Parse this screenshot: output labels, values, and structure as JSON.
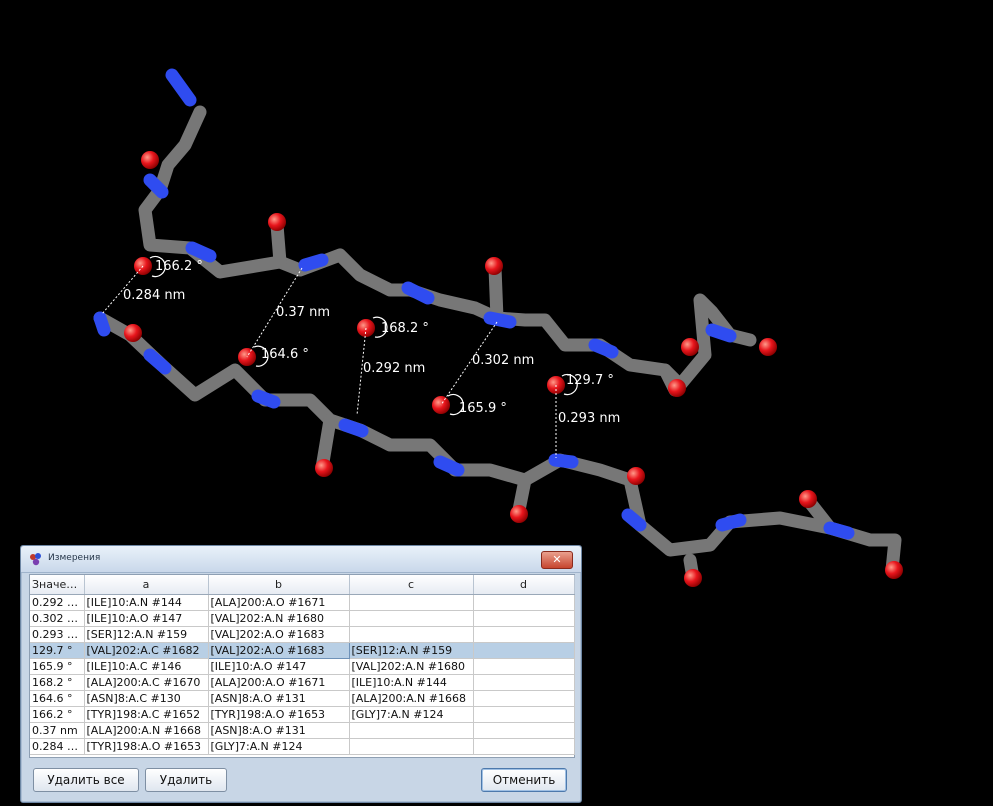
{
  "measurements_3d": {
    "labels": [
      {
        "id": "angle-166-2",
        "text": "166.2 °"
      },
      {
        "id": "dist-0-284",
        "text": "0.284 nm"
      },
      {
        "id": "dist-0-37",
        "text": "0.37 nm"
      },
      {
        "id": "angle-164-6",
        "text": "164.6 °"
      },
      {
        "id": "angle-168-2",
        "text": "168.2 °"
      },
      {
        "id": "dist-0-292",
        "text": "0.292 nm"
      },
      {
        "id": "dist-0-302",
        "text": "0.302 nm"
      },
      {
        "id": "angle-165-9",
        "text": "165.9 °"
      },
      {
        "id": "angle-129-7",
        "text": "129.7 °"
      },
      {
        "id": "dist-0-293",
        "text": "0.293 nm"
      }
    ]
  },
  "dialog": {
    "title": "Измерения",
    "columns": [
      "Значен...",
      "a",
      "b",
      "c",
      "d"
    ],
    "rows": [
      [
        "0.292 n...",
        "[ILE]10:A.N #144",
        "[ALA]200:A.O #1671",
        "",
        ""
      ],
      [
        "0.302 n...",
        "[ILE]10:A.O #147",
        "[VAL]202:A.N #1680",
        "",
        ""
      ],
      [
        "0.293 n...",
        "[SER]12:A.N #159",
        "[VAL]202:A.O #1683",
        "",
        ""
      ],
      [
        "129.7 °",
        "[VAL]202:A.C #1682",
        "[VAL]202:A.O #1683",
        "[SER]12:A.N #159",
        ""
      ],
      [
        "165.9 °",
        "[ILE]10:A.C #146",
        "[ILE]10:A.O #147",
        "[VAL]202:A.N #1680",
        ""
      ],
      [
        "168.2 °",
        "[ALA]200:A.C #1670",
        "[ALA]200:A.O #1671",
        "[ILE]10:A.N #144",
        ""
      ],
      [
        "164.6 °",
        "[ASN]8:A.C #130",
        "[ASN]8:A.O #131",
        "[ALA]200:A.N #1668",
        ""
      ],
      [
        "166.2 °",
        "[TYR]198:A.C #1652",
        "[TYR]198:A.O #1653",
        "[GLY]7:A.N #124",
        ""
      ],
      [
        "0.37 nm",
        "[ALA]200:A.N #1668",
        "[ASN]8:A.O #131",
        "",
        ""
      ],
      [
        "0.284 n...",
        "[TYR]198:A.O #1653",
        "[GLY]7:A.N #124",
        "",
        ""
      ]
    ],
    "selected_row": 3,
    "buttons": {
      "delete_all": "Удалить все",
      "delete": "Удалить",
      "cancel": "Отменить"
    },
    "close_glyph": "✕"
  },
  "colors": {
    "carbon": "#7a7a7a",
    "nitrogen": "#2f4cf0",
    "oxygen": "#e8151c",
    "background": "#000000"
  }
}
